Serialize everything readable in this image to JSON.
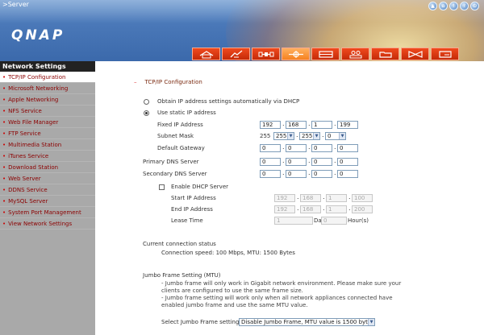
{
  "window": {
    "breadcrumb": ">Server",
    "logo": "QNAP"
  },
  "top_icons": [
    "up-arrow-icon",
    "home-icon",
    "help-icon",
    "question-icon",
    "logout-icon"
  ],
  "toolbar": {
    "buttons": [
      "home-icon",
      "wizard-icon",
      "system-tools-icon",
      "network-services-icon",
      "disk-icon",
      "users-icon",
      "folder-icon",
      "bowtie-icon",
      "file-icon"
    ],
    "active_index": 3
  },
  "sidebar": {
    "title": "Network Settings",
    "items": [
      "TCP/IP Configuration",
      "Microsoft Networking",
      "Apple Networking",
      "NFS Service",
      "Web File Manager",
      "FTP Service",
      "Multimedia Station",
      "iTunes Service",
      "Download Station",
      "Web Server",
      "DDNS Service",
      "MySQL Server",
      "System Port Management",
      "View Network Settings"
    ],
    "active_index": 0
  },
  "tcpip": {
    "section_title": "TCP/IP Configuration",
    "dhcp_option": "Obtain IP address settings automatically via DHCP",
    "static_option": "Use static IP address",
    "fixed_ip_label": "Fixed IP Address",
    "fixed_ip": [
      "192",
      "168",
      "1",
      "199"
    ],
    "subnet_label": "Subnet Mask",
    "subnet": [
      "255",
      "255",
      "255",
      "0"
    ],
    "gateway_label": "Default Gateway",
    "gateway": [
      "0",
      "0",
      "0",
      "0"
    ],
    "primary_dns_label": "Primary DNS Server",
    "primary_dns": [
      "0",
      "0",
      "0",
      "0"
    ],
    "secondary_dns_label": "Secondary DNS Server",
    "secondary_dns": [
      "0",
      "0",
      "0",
      "0"
    ]
  },
  "dhcp_server": {
    "enable_label": "Enable DHCP Server",
    "start_label": "Start IP Address",
    "start_ip": [
      "192",
      "168",
      "1",
      "100"
    ],
    "end_label": "End IP Address",
    "end_ip": [
      "192",
      "168",
      "1",
      "200"
    ],
    "lease_label": "Lease Time",
    "lease_days": "1",
    "days_unit": "Day(s)",
    "lease_hours": "0",
    "hours_unit": "Hour(s)"
  },
  "status": {
    "title": "Current connection status",
    "text": "Connection speed: 100 Mbps, MTU: 1500 Bytes"
  },
  "jumbo": {
    "title": "Jumbo Frame Setting (MTU)",
    "note1": "- Jumbo frame will only work in Gigabit network environment. Please make sure your clients are configured to use the same frame size.",
    "note2": "- Jumbo frame setting will work only when all network appliances connected have enabled jumbo frame and use the same MTU value.",
    "select_label": "Select Jumbo Frame setting:",
    "select_value": "Disable Jumbo Frame, MTU value is 1500 bytes"
  }
}
